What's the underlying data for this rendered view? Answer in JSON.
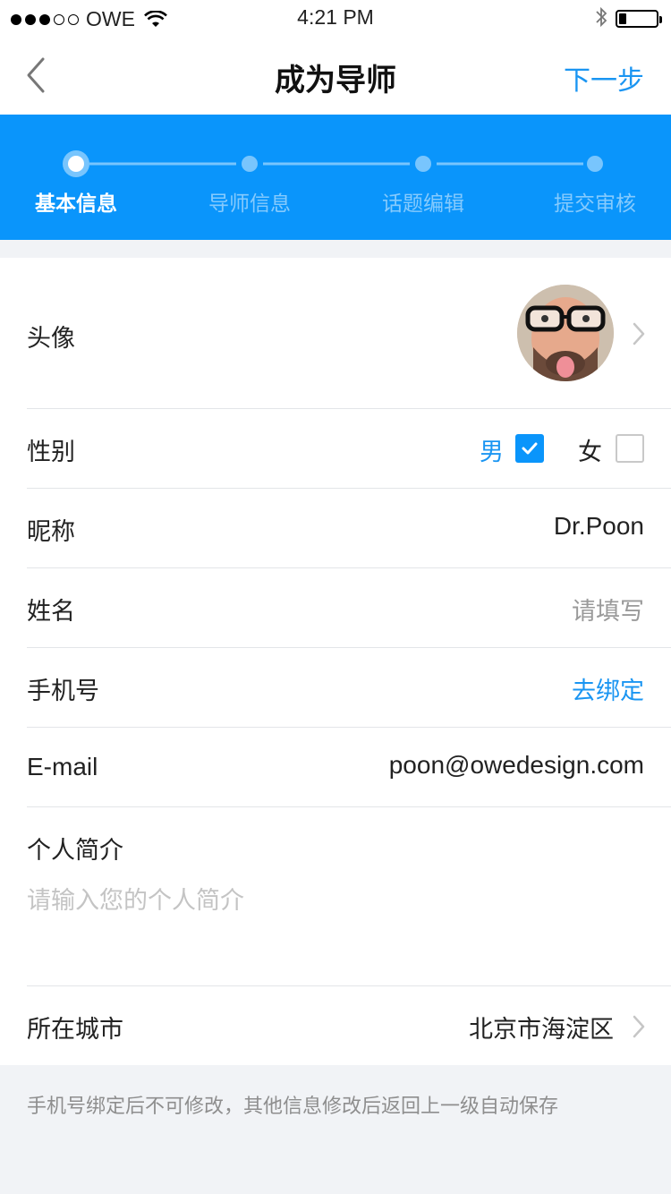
{
  "status_bar": {
    "carrier": "OWE",
    "time": "4:21 PM"
  },
  "nav": {
    "title": "成为导师",
    "next_label": "下一步"
  },
  "steps": {
    "items": [
      {
        "label": "基本信息",
        "active": true
      },
      {
        "label": "导师信息",
        "active": false
      },
      {
        "label": "话题编辑",
        "active": false
      },
      {
        "label": "提交审核",
        "active": false
      }
    ]
  },
  "form": {
    "avatar": {
      "label": "头像"
    },
    "gender": {
      "label": "性别",
      "male": "男",
      "female": "女",
      "selected": "男"
    },
    "nickname": {
      "label": "昵称",
      "value": "Dr.Poon"
    },
    "name": {
      "label": "姓名",
      "placeholder": "请填写"
    },
    "phone": {
      "label": "手机号",
      "action": "去绑定"
    },
    "email": {
      "label": "E-mail",
      "value": "poon@owedesign.com"
    },
    "bio": {
      "label": "个人简介",
      "placeholder": "请输入您的个人简介"
    },
    "city": {
      "label": "所在城市",
      "value": "北京市海淀区"
    }
  },
  "footer": {
    "note": "手机号绑定后不可修改，其他信息修改后返回上一级自动保存"
  },
  "colors": {
    "accent": "#0a95fb",
    "link": "#1a95f2"
  }
}
